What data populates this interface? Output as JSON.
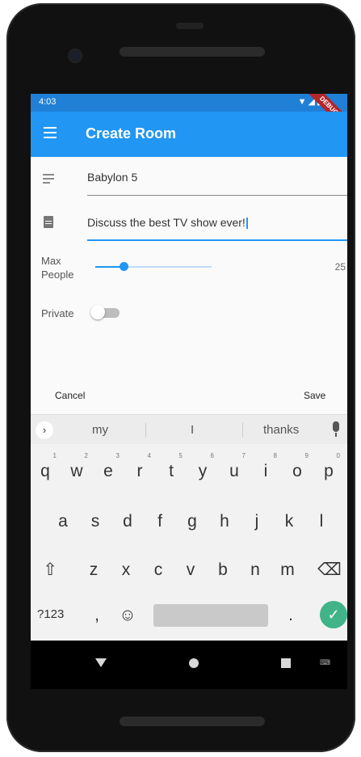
{
  "status": {
    "time": "4:03",
    "icons": "▼◢▮",
    "banner": "DEBUG"
  },
  "appbar": {
    "title": "Create Room"
  },
  "form": {
    "name_value": "Babylon 5",
    "description_value": "Discuss the best TV show ever!",
    "max_people_label_line1": "Max",
    "max_people_label_line2": "People",
    "max_people_value": "25",
    "max_people_slider_fraction": 0.17,
    "private_label": "Private",
    "private_enabled": false
  },
  "actions": {
    "cancel": "Cancel",
    "save": "Save"
  },
  "keyboard": {
    "suggestions": [
      "my",
      "I",
      "thanks"
    ],
    "row1": [
      "q",
      "w",
      "e",
      "r",
      "t",
      "y",
      "u",
      "i",
      "o",
      "p"
    ],
    "row1_hints": [
      "1",
      "2",
      "3",
      "4",
      "5",
      "6",
      "7",
      "8",
      "9",
      "0"
    ],
    "row2": [
      "a",
      "s",
      "d",
      "f",
      "g",
      "h",
      "j",
      "k",
      "l"
    ],
    "row3": [
      "z",
      "x",
      "c",
      "v",
      "b",
      "n",
      "m"
    ],
    "mode_key": "?123",
    "comma": ",",
    "period": ".",
    "emoji": "☺",
    "shift": "⇧",
    "backspace": "⌫",
    "enter": "✓",
    "chevron": "›"
  }
}
